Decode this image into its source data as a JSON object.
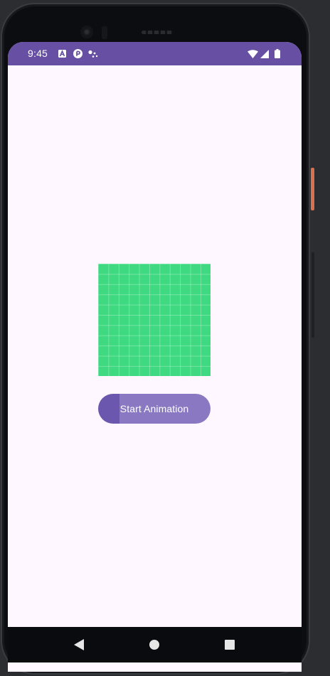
{
  "status_bar": {
    "time": "9:45",
    "background_color": "#6750a4",
    "icons": [
      "notification-a-icon",
      "notification-p-icon",
      "notification-dots-icon",
      "wifi-icon",
      "cell-signal-icon",
      "battery-icon"
    ]
  },
  "screen": {
    "background_color": "#fef7ff"
  },
  "animation_box": {
    "color": "#3fd981"
  },
  "start_button": {
    "label": "Start Animation",
    "color": "#8a79c2"
  },
  "nav_bar": {
    "icons": [
      "back-icon",
      "home-icon",
      "recents-icon"
    ]
  }
}
